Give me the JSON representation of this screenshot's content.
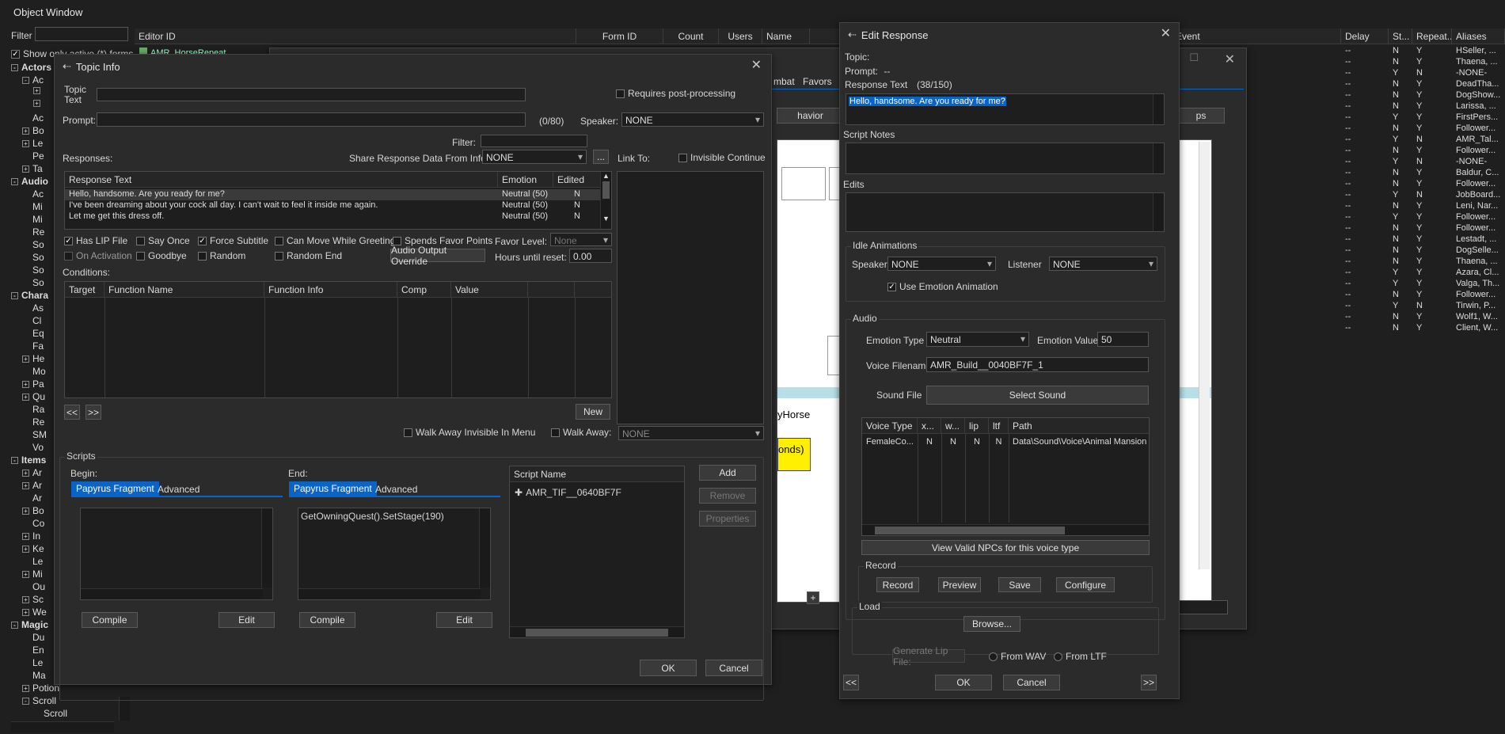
{
  "object_window": {
    "title": "Object Window",
    "filter_label": "Filter",
    "show_only_label": "Show only active (*) forms",
    "columns": [
      "Editor ID",
      "Form ID",
      "Count",
      "Users",
      "Name"
    ],
    "first_row": "AMR_HorseRepeat",
    "tree": [
      {
        "label": "Actors",
        "level": 0,
        "exp": "-"
      },
      {
        "label": "Ac",
        "level": 1,
        "exp": "-"
      },
      {
        "label": "",
        "level": 2,
        "exp": "+"
      },
      {
        "label": "",
        "level": 2,
        "exp": "+"
      },
      {
        "label": "Ac",
        "level": 1,
        "exp": ""
      },
      {
        "label": "Bo",
        "level": 1,
        "exp": "+"
      },
      {
        "label": "Le",
        "level": 1,
        "exp": "+"
      },
      {
        "label": "Pe",
        "level": 1,
        "exp": ""
      },
      {
        "label": "Ta",
        "level": 1,
        "exp": "+"
      },
      {
        "label": "Audio",
        "level": 0,
        "exp": "-"
      },
      {
        "label": "Ac",
        "level": 1,
        "exp": ""
      },
      {
        "label": "Mi",
        "level": 1,
        "exp": ""
      },
      {
        "label": "Mi",
        "level": 1,
        "exp": ""
      },
      {
        "label": "Re",
        "level": 1,
        "exp": ""
      },
      {
        "label": "So",
        "level": 1,
        "exp": ""
      },
      {
        "label": "So",
        "level": 1,
        "exp": ""
      },
      {
        "label": "So",
        "level": 1,
        "exp": ""
      },
      {
        "label": "So",
        "level": 1,
        "exp": ""
      },
      {
        "label": "Chara",
        "level": 0,
        "exp": "-"
      },
      {
        "label": "As",
        "level": 1,
        "exp": ""
      },
      {
        "label": "Cl",
        "level": 1,
        "exp": ""
      },
      {
        "label": "Eq",
        "level": 1,
        "exp": ""
      },
      {
        "label": "Fa",
        "level": 1,
        "exp": ""
      },
      {
        "label": "He",
        "level": 1,
        "exp": "+"
      },
      {
        "label": "Mo",
        "level": 1,
        "exp": ""
      },
      {
        "label": "Pa",
        "level": 1,
        "exp": "+"
      },
      {
        "label": "Qu",
        "level": 1,
        "exp": "+"
      },
      {
        "label": "Ra",
        "level": 1,
        "exp": ""
      },
      {
        "label": "Re",
        "level": 1,
        "exp": ""
      },
      {
        "label": "SM",
        "level": 1,
        "exp": ""
      },
      {
        "label": "Vo",
        "level": 1,
        "exp": ""
      },
      {
        "label": "Items",
        "level": 0,
        "exp": "-"
      },
      {
        "label": "Ar",
        "level": 1,
        "exp": "+"
      },
      {
        "label": "Ar",
        "level": 1,
        "exp": "+"
      },
      {
        "label": "Ar",
        "level": 1,
        "exp": ""
      },
      {
        "label": "Bo",
        "level": 1,
        "exp": "+"
      },
      {
        "label": "Co",
        "level": 1,
        "exp": ""
      },
      {
        "label": "In",
        "level": 1,
        "exp": "+"
      },
      {
        "label": "Ke",
        "level": 1,
        "exp": "+"
      },
      {
        "label": "Le",
        "level": 1,
        "exp": ""
      },
      {
        "label": "Mi",
        "level": 1,
        "exp": "+"
      },
      {
        "label": "Ou",
        "level": 1,
        "exp": ""
      },
      {
        "label": "Sc",
        "level": 1,
        "exp": "+"
      },
      {
        "label": "We",
        "level": 1,
        "exp": "+"
      },
      {
        "label": "Magic",
        "level": 0,
        "exp": "-"
      },
      {
        "label": "Du",
        "level": 1,
        "exp": ""
      },
      {
        "label": "En",
        "level": 1,
        "exp": ""
      },
      {
        "label": "Le",
        "level": 1,
        "exp": ""
      },
      {
        "label": "Ma",
        "level": 1,
        "exp": ""
      },
      {
        "label": "Potion",
        "level": 1,
        "exp": "+"
      },
      {
        "label": "Scroll",
        "level": 1,
        "exp": "-"
      },
      {
        "label": "Scroll",
        "level": 2,
        "exp": ""
      }
    ]
  },
  "right_list": {
    "columns": [
      "Event",
      "Delay",
      "St...",
      "Repeat...",
      "Aliases"
    ],
    "rows": [
      [
        "--",
        "N",
        "Y",
        "HSeller, ..."
      ],
      [
        "--",
        "N",
        "Y",
        "Thaena, ..."
      ],
      [
        "--",
        "Y",
        "N",
        "-NONE-"
      ],
      [
        "--",
        "N",
        "Y",
        "DeadTha..."
      ],
      [
        "--",
        "N",
        "Y",
        "DogShow..."
      ],
      [
        "--",
        "N",
        "Y",
        "Larissa, ..."
      ],
      [
        "--",
        "Y",
        "Y",
        "FirstPers..."
      ],
      [
        "--",
        "N",
        "Y",
        "Follower..."
      ],
      [
        "--",
        "Y",
        "N",
        "AMR_Tal..."
      ],
      [
        "--",
        "N",
        "Y",
        "Follower..."
      ],
      [
        "--",
        "Y",
        "N",
        "-NONE-"
      ],
      [
        "--",
        "N",
        "Y",
        "Baldur, C..."
      ],
      [
        "--",
        "N",
        "Y",
        "Follower..."
      ],
      [
        "--",
        "Y",
        "N",
        "JobBoard..."
      ],
      [
        "--",
        "N",
        "Y",
        "Leni, Nar..."
      ],
      [
        "--",
        "Y",
        "Y",
        "Follower..."
      ],
      [
        "--",
        "N",
        "Y",
        "Follower..."
      ],
      [
        "--",
        "N",
        "Y",
        "Lestadt, ..."
      ],
      [
        "--",
        "N",
        "Y",
        "DogSelle..."
      ],
      [
        "--",
        "N",
        "Y",
        "Thaena, ..."
      ],
      [
        "--",
        "Y",
        "Y",
        "Azara, Cl..."
      ],
      [
        "--",
        "Y",
        "Y",
        "Valga, Th..."
      ],
      [
        "--",
        "N",
        "Y",
        "Follower..."
      ],
      [
        "--",
        "Y",
        "N",
        "Tirwin, P..."
      ],
      [
        "--",
        "N",
        "Y",
        "Wolf1, W..."
      ],
      [
        "--",
        "N",
        "Y",
        "Client, W..."
      ]
    ]
  },
  "mid_window": {
    "tabs": [
      "mbat",
      "Favors"
    ],
    "behavior_btn": "havior",
    "ps_btn": "ps",
    "horse_text": "yHorse",
    "onds_text": "onds)"
  },
  "topic_info": {
    "title": "Topic Info",
    "topic_text_label": "Topic Text",
    "requires_post": "Requires post-processing",
    "prompt_label": "Prompt:",
    "prompt_count": "(0/80)",
    "speaker_label": "Speaker:",
    "speaker_value": "NONE",
    "filter_label": "Filter:",
    "responses_label": "Responses:",
    "share_label": "Share Response Data From Info:",
    "share_value": "NONE",
    "share_btn": "...",
    "link_to": "Link To:",
    "invisible_continue": "Invisible Continue",
    "resp_columns": [
      "Response Text",
      "Emotion",
      "Edited"
    ],
    "responses": [
      [
        "Hello, handsome. Are you ready for me?",
        "Neutral (50)",
        "N"
      ],
      [
        "I've been dreaming about your cock all day. I can't wait to feel it inside me again.",
        "Neutral (50)",
        "N"
      ],
      [
        "Let me get this dress off.",
        "Neutral (50)",
        "N"
      ]
    ],
    "has_lip": "Has LIP File",
    "say_once": "Say Once",
    "force_subtitle": "Force Subtitle",
    "can_move": "Can Move While Greeting",
    "spends_favor": "Spends Favor Points",
    "favor_level": "Favor Level:",
    "favor_value": "None",
    "on_activation": "On Activation",
    "goodbye": "Goodbye",
    "random": "Random",
    "random_end": "Random End",
    "audio_override": "Audio Output Override",
    "hours_label": "Hours until reset:",
    "hours_value": "0.00",
    "conditions_label": "Conditions:",
    "cond_columns": [
      "Target",
      "Function Name",
      "Function Info",
      "Comp",
      "Value"
    ],
    "prev_btn": "<<",
    "next_btn": ">>",
    "new_btn": "New",
    "walk_invisible": "Walk Away Invisible In Menu",
    "walk_away": "Walk Away:",
    "walk_value": "NONE",
    "scripts_label": "Scripts",
    "begin_label": "Begin:",
    "end_label": "End:",
    "papyrus_tab": "Papyrus Fragment",
    "advanced_tab": "Advanced",
    "end_code": "GetOwningQuest().SetStage(190)",
    "compile": "Compile",
    "edit": "Edit",
    "script_name_col": "Script Name",
    "script_item": "AMR_TIF__0640BF7F",
    "add_btn": "Add",
    "remove_btn": "Remove",
    "properties_btn": "Properties",
    "ok": "OK",
    "cancel": "Cancel"
  },
  "edit_response": {
    "title": "Edit Response",
    "topic_label": "Topic:",
    "prompt_label": "Prompt:",
    "prompt_value": "--",
    "resp_text_label": "Response Text",
    "resp_count": "(38/150)",
    "resp_text": "Hello, handsome. Are you ready for me?",
    "script_notes": "Script Notes",
    "edits": "Edits",
    "idle_label": "Idle Animations",
    "speaker_label": "Speaker",
    "speaker_value": "NONE",
    "listener_label": "Listener",
    "listener_value": "NONE",
    "use_emotion": "Use Emotion Animation",
    "audio_label": "Audio",
    "emotion_type_label": "Emotion Type",
    "emotion_type_value": "Neutral",
    "emotion_value_label": "Emotion Value",
    "emotion_value": "50",
    "voice_filename_label": "Voice Filename",
    "voice_filename": "AMR_Build__0040BF7F_1",
    "sound_file_label": "Sound File",
    "select_sound": "Select Sound",
    "vt_columns": [
      "Voice Type",
      "x...",
      "w...",
      "lip",
      "ltf",
      "Path"
    ],
    "vt_row": [
      "FemaleCo...",
      "N",
      "N",
      "N",
      "N",
      "Data\\Sound\\Voice\\Animal Mansion"
    ],
    "view_valid": "View Valid NPCs for this voice type",
    "record_label": "Record",
    "record_btn": "Record",
    "preview_btn": "Preview",
    "save_btn": "Save",
    "configure_btn": "Configure",
    "load_label": "Load",
    "browse_btn": "Browse...",
    "gen_lip": "Generate Lip File:",
    "from_wav": "From WAV",
    "from_ltf": "From LTF",
    "prev_btn": "<<",
    "next_btn": ">>",
    "ok": "OK",
    "cancel": "Cancel"
  }
}
